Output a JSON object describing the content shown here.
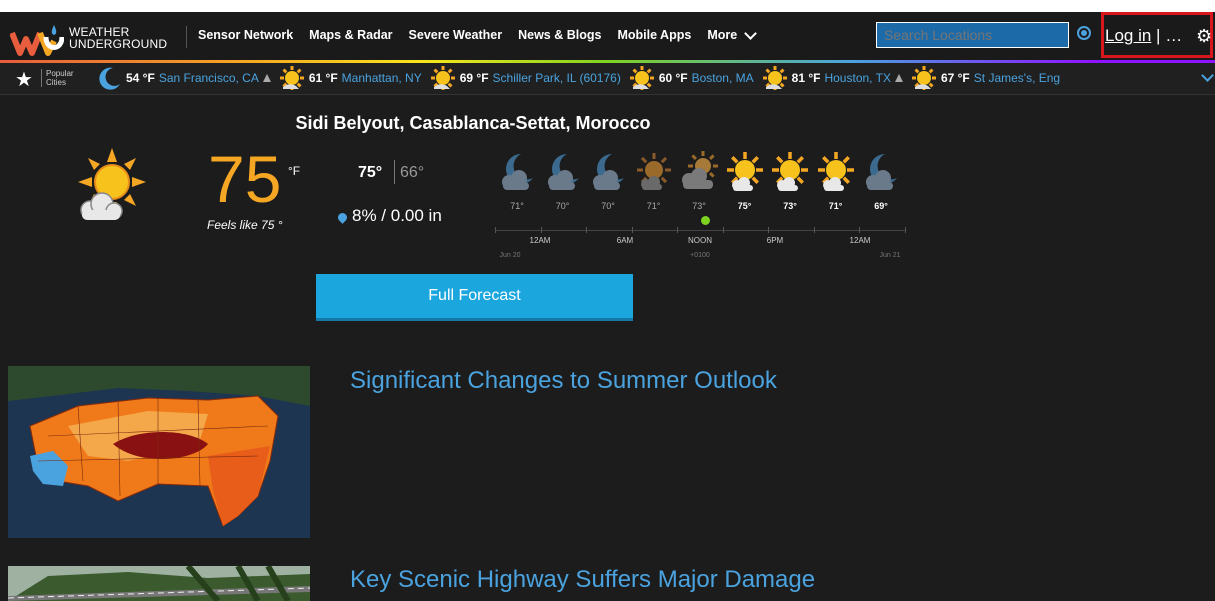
{
  "brand": {
    "line1": "WEATHER",
    "line2": "UNDERGROUND"
  },
  "nav": {
    "items": [
      "Sensor Network",
      "Maps & Radar",
      "Severe Weather",
      "News & Blogs",
      "Mobile Apps"
    ],
    "more": "More"
  },
  "search": {
    "placeholder": "Search Locations"
  },
  "account": {
    "login": "Log in",
    "separator": " | …"
  },
  "citybar": {
    "label_line1": "Popular",
    "label_line2": "Cities",
    "cities": [
      {
        "icon": "moon-icon",
        "temp": "54 °F",
        "name": "San Francisco, CA",
        "flag": "triangle-icon"
      },
      {
        "icon": "sun-icon",
        "temp": "61 °F",
        "name": "Manhattan, NY",
        "flag": ""
      },
      {
        "icon": "sun-icon",
        "temp": "69 °F",
        "name": "Schiller Park, IL (60176)",
        "flag": ""
      },
      {
        "icon": "sun-icon",
        "temp": "60 °F",
        "name": "Boston, MA",
        "flag": ""
      },
      {
        "icon": "sun-icon",
        "temp": "81 °F",
        "name": "Houston, TX",
        "flag": "triangle-icon"
      },
      {
        "icon": "sun-icon",
        "temp": "67 °F",
        "name": "St James's, Eng",
        "flag": ""
      }
    ]
  },
  "current": {
    "location": "Sidi Belyout, Casablanca-Settat, Morocco",
    "temp": "75",
    "unit": "°F",
    "feels_like": "Feels like 75 °",
    "high": "75°",
    "low": "66°",
    "precip": "8% / 0.00 in",
    "icon": "partly-cloudy-sun-icon"
  },
  "hourly": {
    "entries": [
      {
        "icon": "moon-cloud-icon",
        "temp": "71°",
        "bold": false
      },
      {
        "icon": "moon-cloud-icon",
        "temp": "70°",
        "bold": false
      },
      {
        "icon": "moon-cloud-icon",
        "temp": "70°",
        "bold": false
      },
      {
        "icon": "sun-dim-icon",
        "temp": "71°",
        "bold": false
      },
      {
        "icon": "sun-cloud-icon",
        "temp": "73°",
        "bold": false
      },
      {
        "icon": "sun-icon",
        "temp": "75°",
        "bold": true
      },
      {
        "icon": "sun-icon",
        "temp": "73°",
        "bold": true
      },
      {
        "icon": "sun-icon",
        "temp": "71°",
        "bold": true
      },
      {
        "icon": "moon-cloud-icon",
        "temp": "69°",
        "bold": true
      }
    ],
    "time_labels": [
      "12AM",
      "6AM",
      "NOON",
      "6PM",
      "12AM"
    ],
    "sub_labels": [
      "Jun 20",
      "+0100",
      "Jun 21"
    ]
  },
  "forecast_button": "Full Forecast",
  "articles": [
    {
      "title": "Significant Changes to Summer Outlook",
      "image": "us-temperature-map"
    },
    {
      "title": "Key Scenic Highway Suffers Major Damage",
      "image": "highway-photo"
    }
  ],
  "colors": {
    "accent": "#1ca6de",
    "temp": "#f5a623",
    "link": "#4aa3df",
    "highlight_border": "#d8171c"
  }
}
